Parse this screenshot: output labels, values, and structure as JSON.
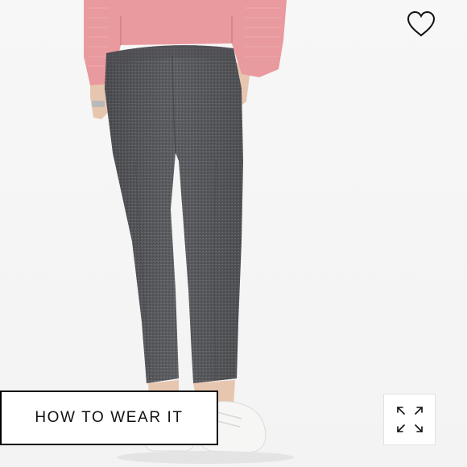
{
  "product_image": {
    "subject": "gray-pants-back-view",
    "colors": {
      "background": "#f5f5f5",
      "sweater": "#e99a9e",
      "pants": "#5b5c60",
      "skin": "#e7c6b0",
      "shoe": "#f6f6f4"
    }
  },
  "wishlist": {
    "icon": "heart-outline-icon"
  },
  "how_to_wear": {
    "label": "HOW TO WEAR IT"
  },
  "expand": {
    "icon": "expand-arrows-icon"
  }
}
